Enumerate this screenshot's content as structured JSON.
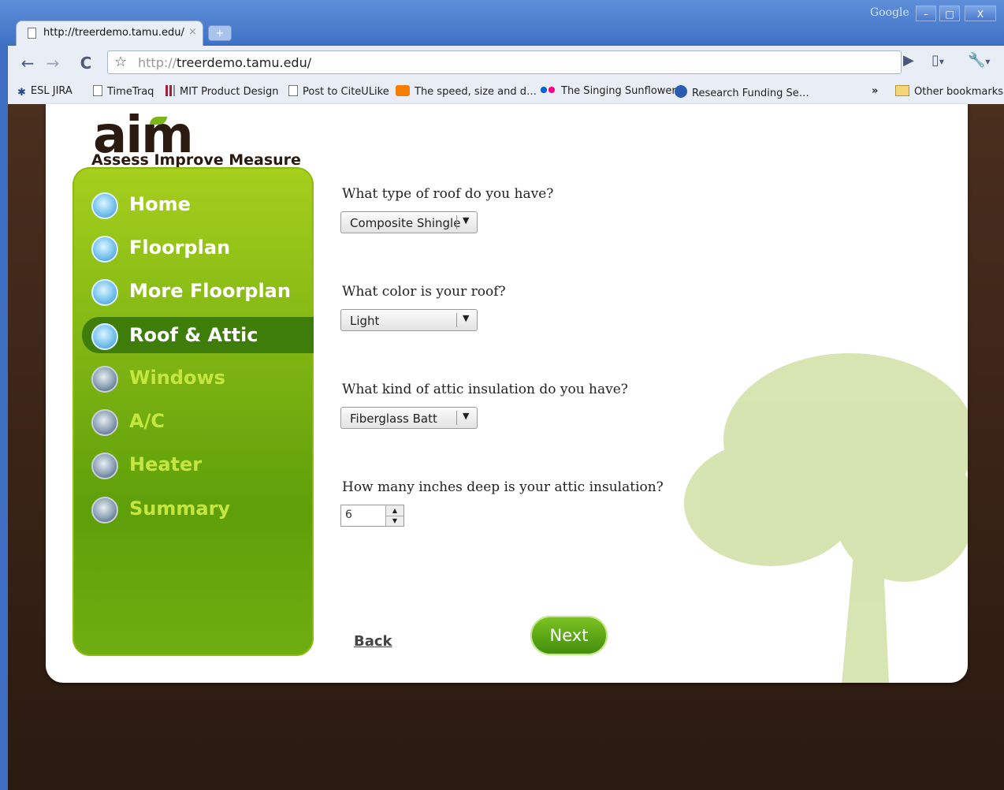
{
  "window": {
    "google_label": "Google",
    "tab_title": "http://treerdemo.tamu.edu/",
    "tab_close": "×",
    "new_tab": "+",
    "minimize": "–",
    "maximize": "□",
    "close": "X"
  },
  "toolbar": {
    "back": "←",
    "forward": "→",
    "reload": "C",
    "star": "☆",
    "url_scheme": "http://",
    "url_host": "treerdemo.tamu.edu/",
    "go": "▶",
    "page_menu": "▾",
    "wrench_menu": "▾"
  },
  "bookmarks": [
    {
      "label": "ESL JIRA",
      "icon": "jira-icon",
      "color": "#1f4a8a"
    },
    {
      "label": "TimeTraq",
      "icon": "page-icon",
      "color": "#ffffff"
    },
    {
      "label": "MIT Product Design",
      "icon": "mit-icon",
      "color": "#a31f34"
    },
    {
      "label": "Post to CiteULike",
      "icon": "page-icon",
      "color": "#ffffff"
    },
    {
      "label": "The speed, size and d…",
      "icon": "blogger-icon",
      "color": "#f57d00"
    },
    {
      "label": "The Singing Sunflower",
      "icon": "flickr-icon",
      "color": "#0063dc"
    },
    {
      "label": "Research Funding Se…",
      "icon": "info-icon",
      "color": "#2a5db0"
    }
  ],
  "bookmarks_overflow": "»",
  "other_bookmarks": "Other bookmarks",
  "logo": {
    "name": "aim",
    "tagline": "Assess Improve Measure"
  },
  "nav": {
    "items": [
      {
        "label": "Home",
        "state": "completed"
      },
      {
        "label": "Floorplan",
        "state": "completed"
      },
      {
        "label": "More Floorplan",
        "state": "completed"
      },
      {
        "label": "Roof & Attic",
        "state": "active"
      },
      {
        "label": "Windows",
        "state": "pending"
      },
      {
        "label": "A/C",
        "state": "pending"
      },
      {
        "label": "Heater",
        "state": "pending"
      },
      {
        "label": "Summary",
        "state": "pending"
      }
    ]
  },
  "form": {
    "q1": {
      "label": "What type of roof do you have?",
      "value": "Composite Shingle"
    },
    "q2": {
      "label": "What color is your roof?",
      "value": "Light"
    },
    "q3": {
      "label": "What kind of attic insulation do you have?",
      "value": "Fiberglass Batt"
    },
    "q4": {
      "label": "How many inches deep is your attic insulation?",
      "value": "6"
    },
    "dropdown_arrow": "▼",
    "spin_up": "▲",
    "spin_down": "▼",
    "back": "Back",
    "next": "Next"
  },
  "colors": {
    "sidebar_green": "#8cc415",
    "active_green": "#3f7d0a",
    "brown_background": "#3a2418"
  }
}
